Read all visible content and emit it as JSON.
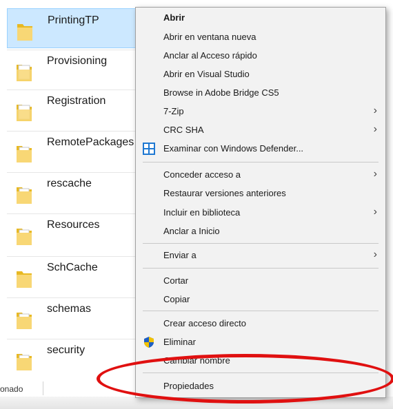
{
  "explorer": {
    "items": [
      {
        "name": "PrintingTP",
        "selected": true
      },
      {
        "name": "Provisioning"
      },
      {
        "name": "Registration"
      },
      {
        "name": "RemotePackages"
      },
      {
        "name": "rescache"
      },
      {
        "name": "Resources"
      },
      {
        "name": "SchCache"
      },
      {
        "name": "schemas"
      },
      {
        "name": "security"
      }
    ],
    "status_text": "onado"
  },
  "context_menu": {
    "items": [
      {
        "label": "Abrir",
        "bold": true
      },
      {
        "label": "Abrir en ventana nueva"
      },
      {
        "label": "Anclar al Acceso rápido"
      },
      {
        "label": "Abrir en Visual Studio"
      },
      {
        "label": "Browse in Adobe Bridge CS5"
      },
      {
        "label": "7-Zip",
        "submenu": true
      },
      {
        "label": "CRC SHA",
        "submenu": true
      },
      {
        "label": "Examinar con Windows Defender...",
        "icon": "windows-defender-icon"
      },
      {
        "label": "Conceder acceso a",
        "submenu": true
      },
      {
        "label": "Restaurar versiones anteriores"
      },
      {
        "label": "Incluir en biblioteca",
        "submenu": true
      },
      {
        "label": "Anclar a Inicio"
      },
      {
        "label": "Enviar a",
        "submenu": true
      },
      {
        "label": "Cortar"
      },
      {
        "label": "Copiar"
      },
      {
        "label": "Crear acceso directo"
      },
      {
        "label": "Eliminar",
        "icon": "uac-shield-icon"
      },
      {
        "label": "Cambiar nombre"
      },
      {
        "label": "Propiedades",
        "highlighted": true
      }
    ],
    "submenu_glyph": "›"
  },
  "colors": {
    "selection": "#cce8ff",
    "menu_background": "#f2f2f2",
    "highlight_ring": "#e01010"
  }
}
